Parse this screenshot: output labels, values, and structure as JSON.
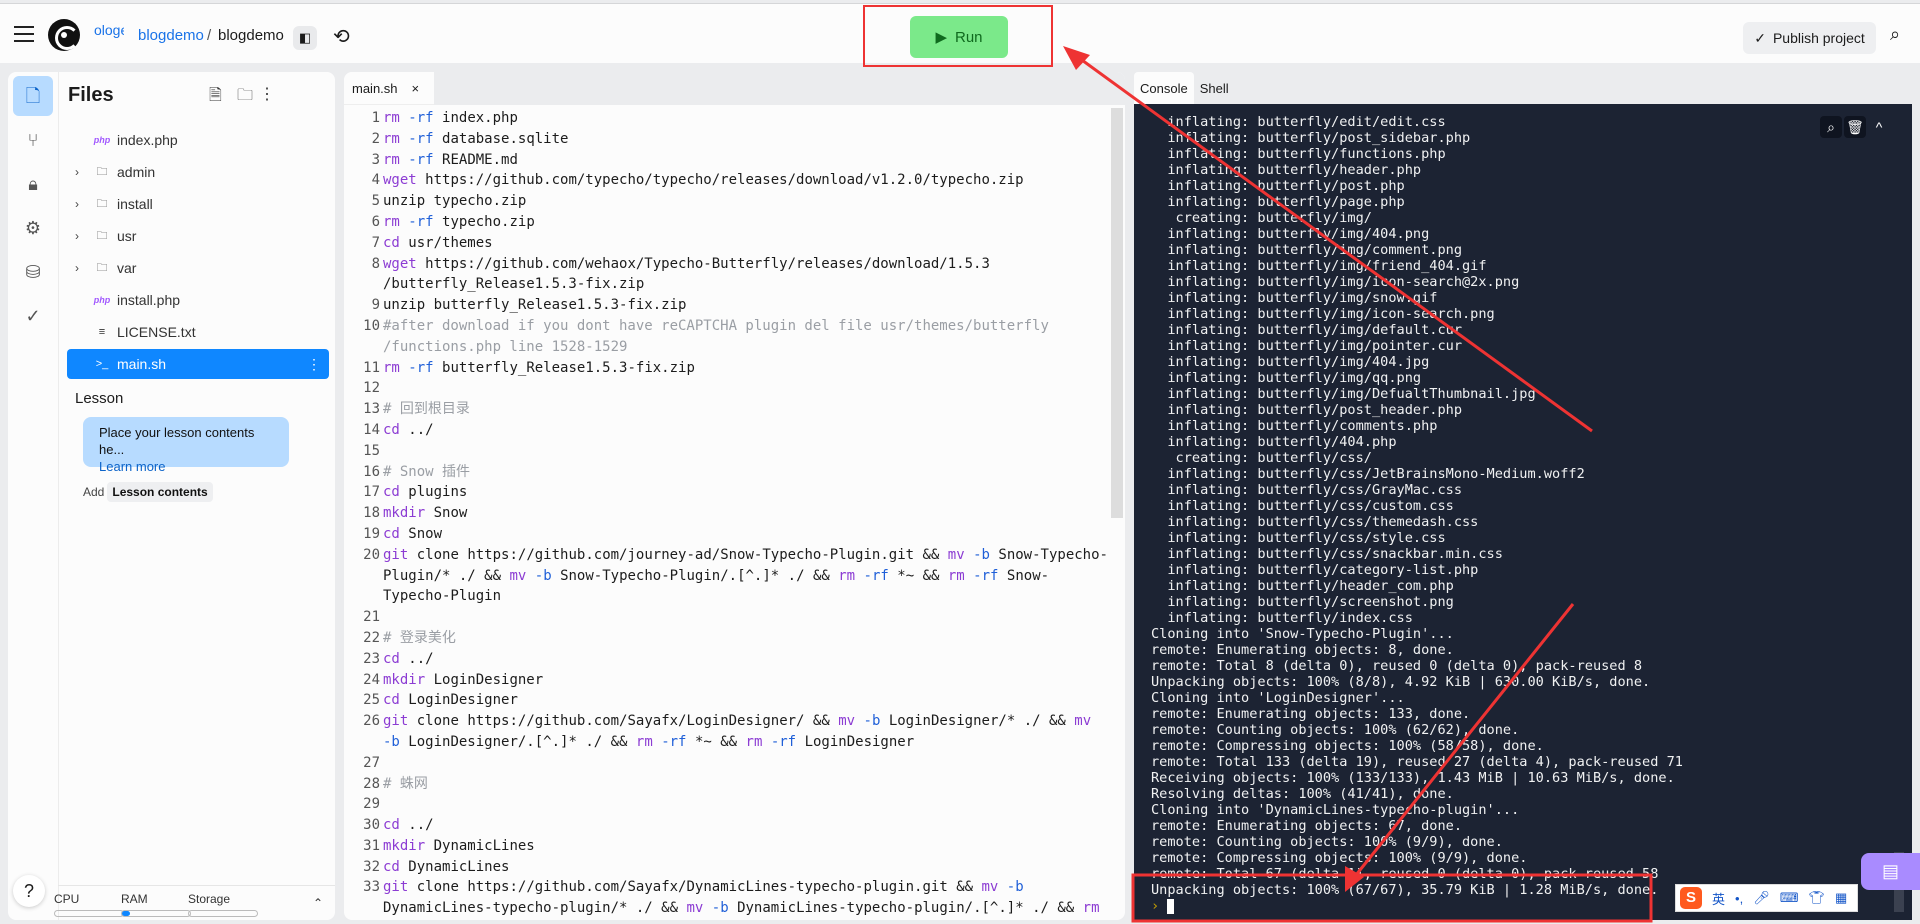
{
  "header": {
    "menu_icon": "hamburger-icon",
    "truncated_text": "ologe",
    "owner": "blogdemo",
    "separator": "/",
    "project": "blogdemo",
    "run_label": "Run",
    "publish_label": "Publish project"
  },
  "rail": [
    "files-icon",
    "git-icon",
    "lock-icon",
    "gear-icon",
    "database-icon",
    "check-icon"
  ],
  "files": {
    "title": "Files",
    "items": [
      {
        "name": "index.php",
        "type": "php"
      },
      {
        "name": "admin",
        "type": "folder"
      },
      {
        "name": "install",
        "type": "folder"
      },
      {
        "name": "usr",
        "type": "folder"
      },
      {
        "name": "var",
        "type": "folder"
      },
      {
        "name": "install.php",
        "type": "php"
      },
      {
        "name": "LICENSE.txt",
        "type": "text"
      },
      {
        "name": "main.sh",
        "type": "shell",
        "selected": true
      }
    ],
    "php_badge": "php"
  },
  "lesson": {
    "title": "Lesson",
    "placeholder": "Place your lesson contents he...",
    "learn_more": "Learn more",
    "add": "Add",
    "add_button": "Lesson contents"
  },
  "resources": {
    "cpu": "CPU",
    "ram": "RAM",
    "storage": "Storage",
    "cpu_usage": 0,
    "ram_usage": 0.05,
    "storage_usage": 0
  },
  "help": "?",
  "editor": {
    "tab": "main.sh",
    "lines": [
      {
        "n": 1,
        "rows": [
          "rm -rf index.php"
        ]
      },
      {
        "n": 2,
        "rows": [
          "rm -rf database.sqlite"
        ]
      },
      {
        "n": 3,
        "rows": [
          "rm -rf README.md"
        ]
      },
      {
        "n": 4,
        "rows": [
          "wget https://github.com/typecho/typecho/releases/download/v1.2.0/typecho.zip"
        ]
      },
      {
        "n": 5,
        "rows": [
          "unzip typecho.zip"
        ]
      },
      {
        "n": 6,
        "rows": [
          "rm -rf typecho.zip"
        ]
      },
      {
        "n": 7,
        "rows": [
          "cd usr/themes"
        ]
      },
      {
        "n": 8,
        "rows": [
          "wget https://github.com/wehaox/Typecho-Butterfly/releases/download/1.5.3",
          "/butterfly_Release1.5.3-fix.zip"
        ]
      },
      {
        "n": 9,
        "rows": [
          "unzip butterfly_Release1.5.3-fix.zip"
        ]
      },
      {
        "n": 10,
        "comment": true,
        "rows": [
          "#after download if you dont have reCAPTCHA plugin del file usr/themes/butterfly",
          "/functions.php line 1528-1529"
        ]
      },
      {
        "n": 11,
        "rows": [
          "rm -rf butterfly_Release1.5.3-fix.zip"
        ]
      },
      {
        "n": 12,
        "rows": [
          ""
        ]
      },
      {
        "n": 13,
        "comment": true,
        "rows": [
          "# 回到根目录"
        ]
      },
      {
        "n": 14,
        "rows": [
          "cd ../"
        ]
      },
      {
        "n": 15,
        "rows": [
          ""
        ]
      },
      {
        "n": 16,
        "comment": true,
        "rows": [
          "# Snow 插件"
        ]
      },
      {
        "n": 17,
        "rows": [
          "cd plugins"
        ]
      },
      {
        "n": 18,
        "rows": [
          "mkdir Snow"
        ]
      },
      {
        "n": 19,
        "rows": [
          "cd Snow"
        ]
      },
      {
        "n": 20,
        "rows": [
          "git clone https://github.com/journey-ad/Snow-Typecho-Plugin.git && mv -b Snow-Typecho-",
          "Plugin/* ./ && mv -b Snow-Typecho-Plugin/.[^.]* ./ && rm -rf *~ && rm -rf Snow-",
          "Typecho-Plugin"
        ]
      },
      {
        "n": 21,
        "rows": [
          ""
        ]
      },
      {
        "n": 22,
        "comment": true,
        "rows": [
          "# 登录美化"
        ]
      },
      {
        "n": 23,
        "rows": [
          "cd ../"
        ]
      },
      {
        "n": 24,
        "rows": [
          "mkdir LoginDesigner"
        ]
      },
      {
        "n": 25,
        "rows": [
          "cd LoginDesigner"
        ]
      },
      {
        "n": 26,
        "rows": [
          "git clone https://github.com/Sayafx/LoginDesigner/ && mv -b LoginDesigner/* ./ && mv",
          "-b LoginDesigner/.[^.]* ./ && rm -rf *~ && rm -rf LoginDesigner"
        ]
      },
      {
        "n": 27,
        "rows": [
          ""
        ]
      },
      {
        "n": 28,
        "comment": true,
        "rows": [
          "# 蛛网"
        ]
      },
      {
        "n": 29,
        "rows": [
          ""
        ]
      },
      {
        "n": 30,
        "rows": [
          "cd ../"
        ]
      },
      {
        "n": 31,
        "rows": [
          "mkdir DynamicLines"
        ]
      },
      {
        "n": 32,
        "rows": [
          "cd DynamicLines"
        ]
      },
      {
        "n": 33,
        "rows": [
          "git clone https://github.com/Sayafx/DynamicLines-typecho-plugin.git && mv -b",
          "DynamicLines-typecho-plugin/* ./ && mv -b DynamicLines-typecho-plugin/.[^.]* ./ && rm"
        ]
      }
    ]
  },
  "console": {
    "tabs": [
      "Console",
      "Shell"
    ],
    "active_tab": "Console",
    "prompt": "›",
    "lines": [
      "  inflating: butterfly/edit/edit.css",
      "  inflating: butterfly/post_sidebar.php",
      "  inflating: butterfly/functions.php",
      "  inflating: butterfly/header.php",
      "  inflating: butterfly/post.php",
      "  inflating: butterfly/page.php",
      "   creating: butterfly/img/",
      "  inflating: butterfly/img/404.png",
      "  inflating: butterfly/img/comment.png",
      "  inflating: butterfly/img/friend_404.gif",
      "  inflating: butterfly/img/icon-search@2x.png",
      "  inflating: butterfly/img/snow.gif",
      "  inflating: butterfly/img/icon-search.png",
      "  inflating: butterfly/img/default.cur",
      "  inflating: butterfly/img/pointer.cur",
      "  inflating: butterfly/img/404.jpg",
      "  inflating: butterfly/img/qq.png",
      "  inflating: butterfly/img/DefualtThumbnail.jpg",
      "  inflating: butterfly/post_header.php",
      "  inflating: butterfly/comments.php",
      "  inflating: butterfly/404.php",
      "   creating: butterfly/css/",
      "  inflating: butterfly/css/JetBrainsMono-Medium.woff2",
      "  inflating: butterfly/css/GrayMac.css",
      "  inflating: butterfly/css/custom.css",
      "  inflating: butterfly/css/themedash.css",
      "  inflating: butterfly/css/style.css",
      "  inflating: butterfly/css/snackbar.min.css",
      "  inflating: butterfly/category-list.php",
      "  inflating: butterfly/header_com.php",
      "  inflating: butterfly/screenshot.png",
      "  inflating: butterfly/index.css",
      "Cloning into 'Snow-Typecho-Plugin'...",
      "remote: Enumerating objects: 8, done.",
      "remote: Total 8 (delta 0), reused 0 (delta 0), pack-reused 8",
      "Unpacking objects: 100% (8/8), 4.92 KiB | 630.00 KiB/s, done.",
      "Cloning into 'LoginDesigner'...",
      "remote: Enumerating objects: 133, done.",
      "remote: Counting objects: 100% (62/62), done.",
      "remote: Compressing objects: 100% (58/58), done.",
      "remote: Total 133 (delta 19), reused 27 (delta 4), pack-reused 71",
      "Receiving objects: 100% (133/133), 1.43 MiB | 10.63 MiB/s, done.",
      "Resolving deltas: 100% (41/41), done.",
      "Cloning into 'DynamicLines-typecho-plugin'...",
      "remote: Enumerating objects: 67, done.",
      "remote: Counting objects: 100% (9/9), done.",
      "remote: Compressing objects: 100% (9/9), done.",
      "remote: Total 67 (delta 1), reused 0 (delta 0), pack-reused 58",
      "Unpacking objects: 100% (67/67), 35.79 KiB | 1.28 MiB/s, done."
    ]
  },
  "ime": {
    "lang": "英",
    "punct": "•,"
  },
  "colors": {
    "annotation": "#ee3333",
    "run_bg": "#7be98a",
    "accent": "#0f87ff",
    "terminal_bg": "#1c2333"
  }
}
